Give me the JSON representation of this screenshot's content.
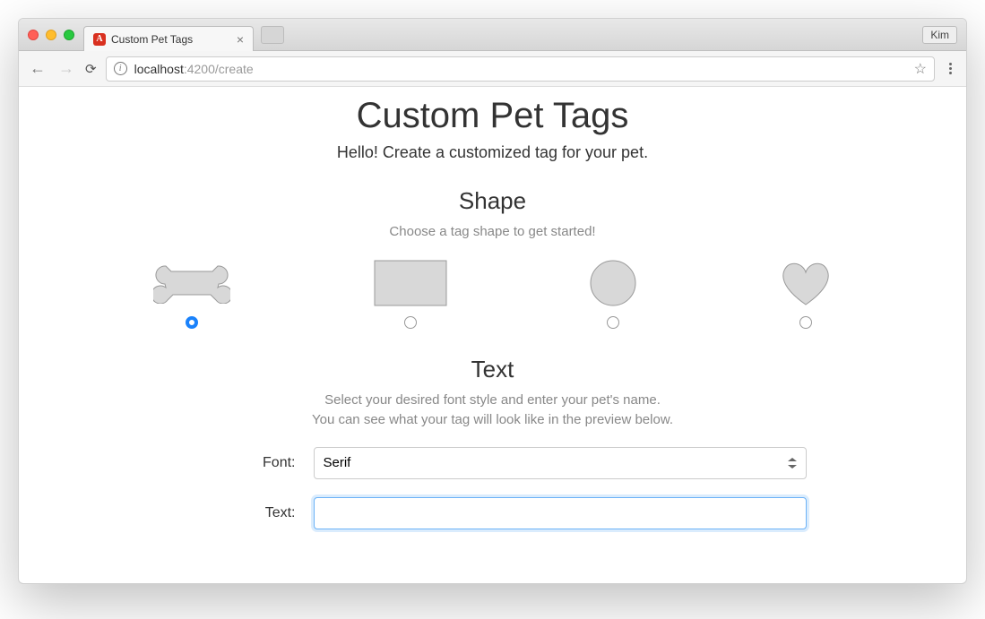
{
  "window": {
    "tab_title": "Custom Pet Tags",
    "user": "Kim"
  },
  "addressbar": {
    "host": "localhost",
    "port_path": ":4200/create"
  },
  "page": {
    "title": "Custom Pet Tags",
    "subtitle": "Hello! Create a customized tag for your pet.",
    "shape_section": {
      "heading": "Shape",
      "hint": "Choose a tag shape to get started!",
      "options": [
        {
          "id": "bone",
          "label": "Bone",
          "selected": true
        },
        {
          "id": "rectangle",
          "label": "Rectangle",
          "selected": false
        },
        {
          "id": "circle",
          "label": "Circle",
          "selected": false
        },
        {
          "id": "heart",
          "label": "Heart",
          "selected": false
        }
      ]
    },
    "text_section": {
      "heading": "Text",
      "hint_line1": "Select your desired font style and enter your pet's name.",
      "hint_line2": "You can see what your tag will look like in the preview below.",
      "font_label": "Font:",
      "font_value": "Serif",
      "text_label": "Text:",
      "text_value": ""
    }
  }
}
